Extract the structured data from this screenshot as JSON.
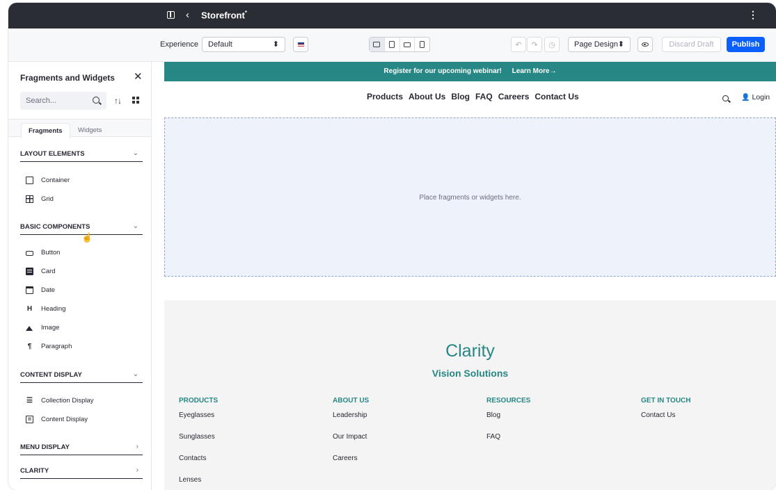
{
  "app": {
    "title": "Storefront",
    "title_marker": "*",
    "back_glyph": "‹",
    "menu_glyph": "⋮"
  },
  "toolbar": {
    "experience_label": "Experience",
    "experience_value": "Default",
    "select_arrow": "⬍",
    "page_design_value": "Page Design",
    "undo_glyph": "↶",
    "redo_glyph": "↷",
    "history_glyph": "◷",
    "discard_label": "Discard Draft",
    "publish_label": "Publish"
  },
  "panel": {
    "title": "Fragments and Widgets",
    "close_glyph": "✕",
    "search_placeholder": "Search...",
    "sort_glyph": "↑↓",
    "tabs": [
      "Fragments",
      "Widgets"
    ],
    "sections": [
      {
        "label": "LAYOUT ELEMENTS",
        "chev": "⌄",
        "items": [
          {
            "label": "Container",
            "icon": "container-icon"
          },
          {
            "label": "Grid",
            "icon": "grid-icon"
          }
        ]
      },
      {
        "label": "BASIC COMPONENTS",
        "chev": "⌄",
        "items": [
          {
            "label": "Button",
            "icon": "button-icon"
          },
          {
            "label": "Card",
            "icon": "card-icon"
          },
          {
            "label": "Date",
            "icon": "calendar-icon"
          },
          {
            "label": "Heading",
            "icon": "heading-icon",
            "glyph": "H"
          },
          {
            "label": "Image",
            "icon": "image-icon"
          },
          {
            "label": "Paragraph",
            "icon": "paragraph-icon",
            "glyph": "¶"
          }
        ]
      },
      {
        "label": "CONTENT DISPLAY",
        "chev": "⌄",
        "items": [
          {
            "label": "Collection Display",
            "icon": "list-icon"
          },
          {
            "label": "Content Display",
            "icon": "content-display-icon"
          }
        ]
      },
      {
        "label": "MENU DISPLAY",
        "chev": "›",
        "items": []
      },
      {
        "label": "CLARITY",
        "chev": "›",
        "items": []
      }
    ]
  },
  "page": {
    "banner_text": "Register for our upcoming webinar!",
    "banner_link": "Learn More→",
    "nav_links": [
      "Products",
      "About Us",
      "Blog",
      "FAQ",
      "Careers",
      "Contact Us"
    ],
    "login_label": "Login",
    "dropzone_message": "Place fragments or widgets here.",
    "brand_name": "Clarity",
    "brand_sub": "Vision Solutions",
    "footer_columns": [
      {
        "heading": "PRODUCTS",
        "links": [
          "Eyeglasses",
          "Sunglasses",
          "Contacts",
          "Lenses"
        ]
      },
      {
        "heading": "ABOUT US",
        "links": [
          "Leadership",
          "Our Impact",
          "Careers"
        ]
      },
      {
        "heading": "RESOURCES",
        "links": [
          "Blog",
          "FAQ"
        ]
      },
      {
        "heading": "GET IN TOUCH",
        "links": [
          "Contact Us"
        ]
      }
    ]
  },
  "colors": {
    "accent": "#268784",
    "publish": "#0b5fff",
    "topbar": "#2b2d34"
  }
}
